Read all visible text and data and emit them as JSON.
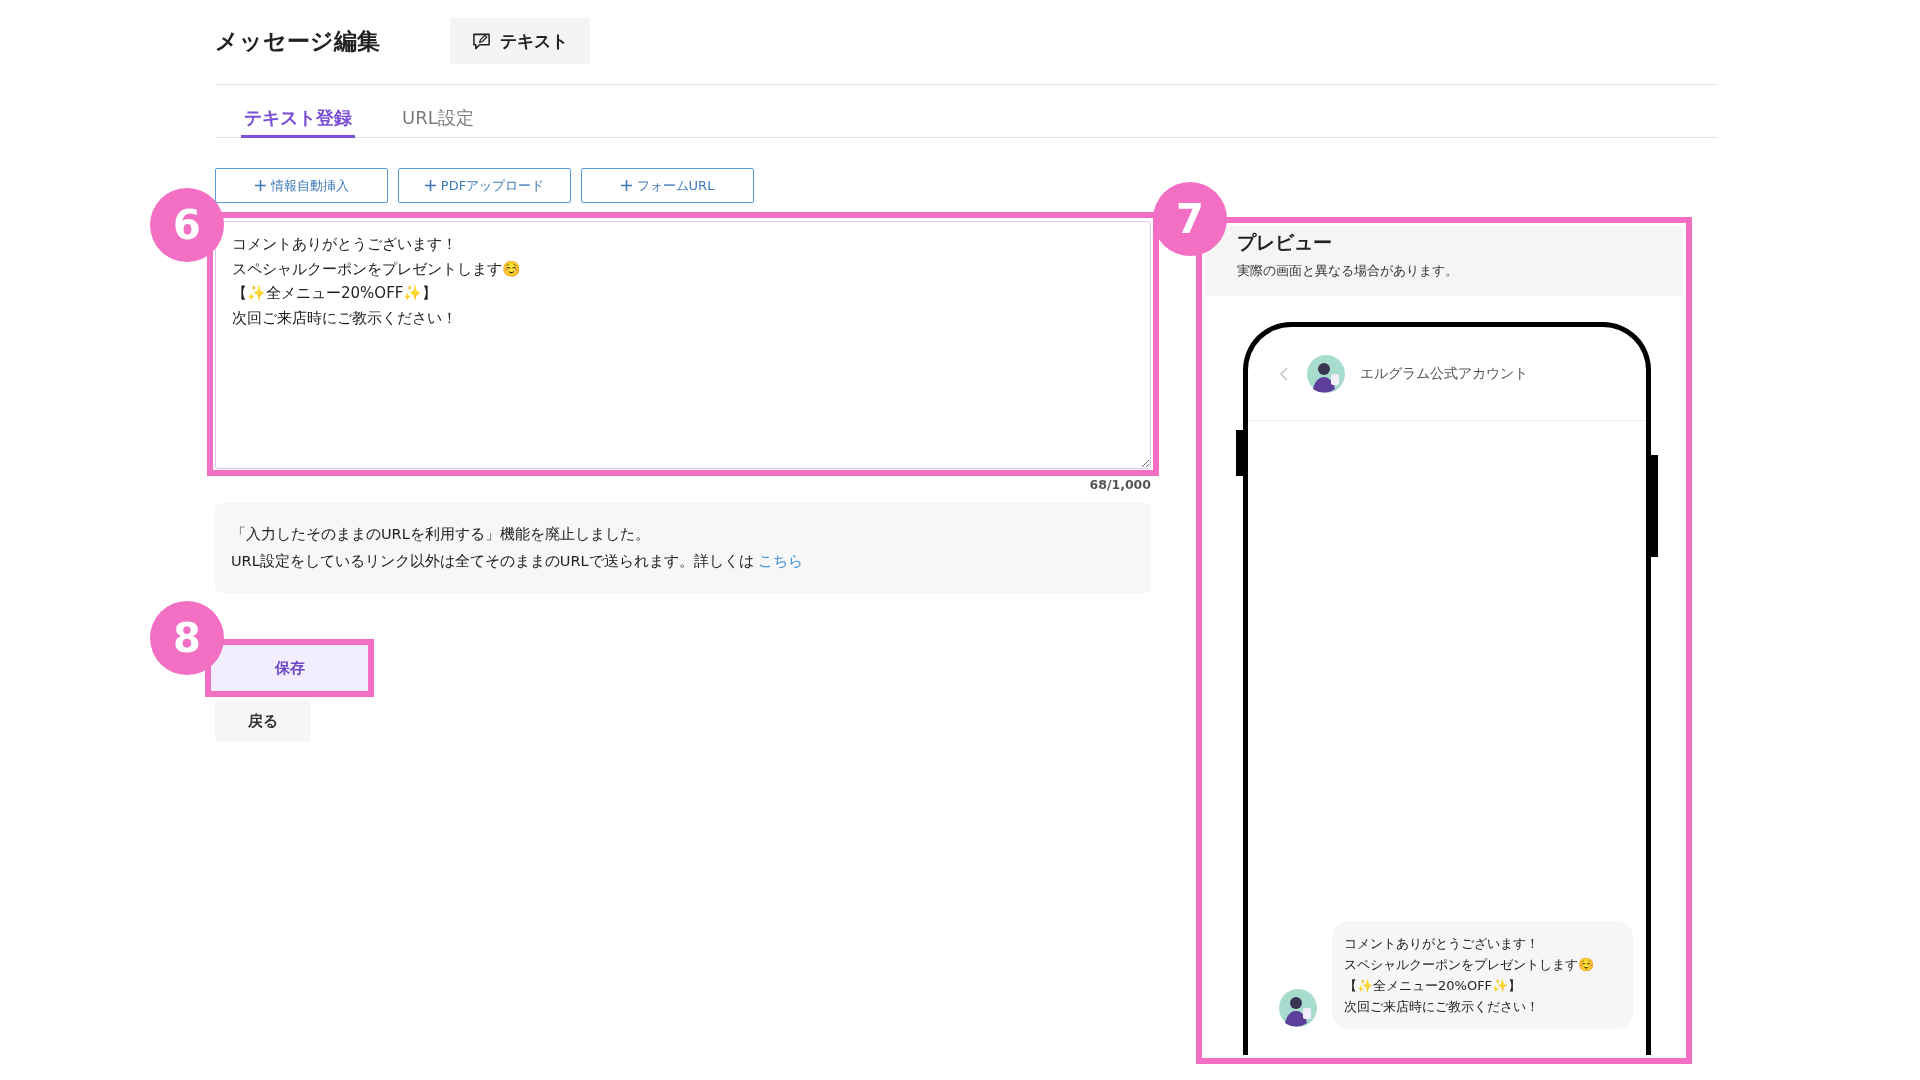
{
  "header": {
    "title": "メッセージ編集",
    "type_tag": "テキスト"
  },
  "tabs": [
    {
      "label": "テキスト登録",
      "selected": true
    },
    {
      "label": "URL設定",
      "selected": false
    }
  ],
  "insert_buttons": [
    "情報自動挿入",
    "PDFアップロード",
    "フォームURL"
  ],
  "editor": {
    "callout": "6",
    "lines": [
      "コメントありがとうございます！",
      "スペシャルクーポンをプレゼントします☺️",
      "【✨全メニュー20%OFF✨】",
      "次回ご来店時にご教示ください！"
    ],
    "counter": "68/1,000"
  },
  "notice": {
    "lines": [
      "「入力したそのままのURLを利用する」機能を廃止しました。",
      "URL設定をしているリンク以外は全てそのままのURLで送られます。詳しくは"
    ],
    "link": "こちら"
  },
  "actions": {
    "callout": "8",
    "save": "保存",
    "back": "戻る"
  },
  "preview": {
    "callout": "7",
    "title": "プレビュー",
    "subtitle": "実際の画面と異なる場合があります。",
    "account_name": "エルグラム公式アカウント",
    "message_lines": [
      "コメントありがとうございます！",
      "スペシャルクーポンをプレゼントします☺️",
      "【✨全メニュー20%OFF✨】",
      "次回ご来店時にご教示ください！"
    ]
  }
}
